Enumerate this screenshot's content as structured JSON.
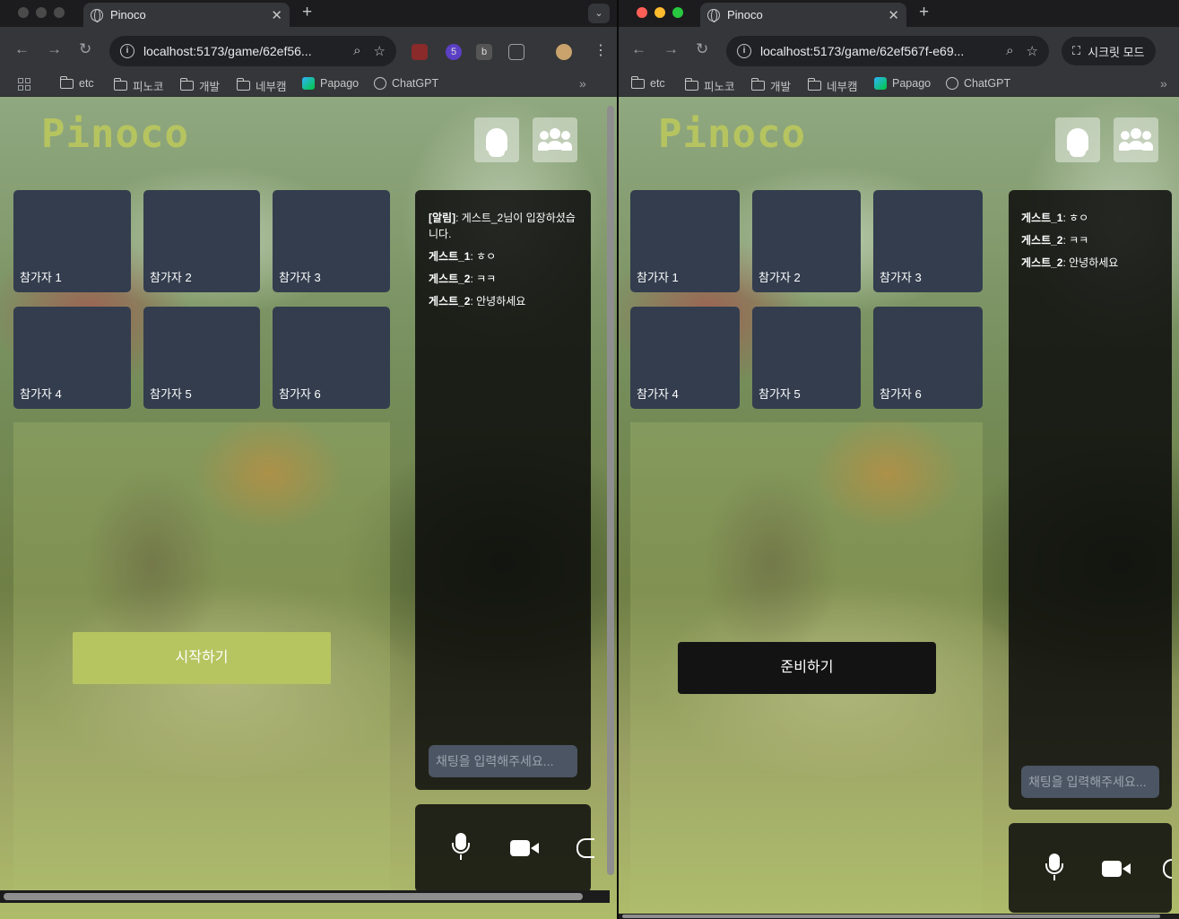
{
  "browser": {
    "tab_title": "Pinoco",
    "left_url": "localhost:5173/game/62ef56...",
    "right_url": "localhost:5173/game/62ef567f-e69...",
    "incognito_label": "시크릿 모드",
    "ext_badge": "5",
    "ext_b": "b",
    "bookmarks": [
      "etc",
      "피노코",
      "개발",
      "네부캠",
      "Papago",
      "ChatGPT"
    ],
    "more_bookmarks": "»"
  },
  "app": {
    "logo": "Pinoco",
    "participants": [
      "참가자 1",
      "참가자 2",
      "참가자 3",
      "참가자 4",
      "참가자 5",
      "참가자 6"
    ],
    "start_label": "시작하기",
    "ready_label": "준비하기",
    "chat_placeholder": "채팅을 입력해주세요...",
    "left_messages": [
      {
        "sender": "[알림]",
        "text": ": 게스트_2님이 입장하셨습니다."
      },
      {
        "sender": "게스트_1",
        "text": ": ㅎㅇ"
      },
      {
        "sender": "게스트_2",
        "text": ": ㅋㅋ"
      },
      {
        "sender": "게스트_2",
        "text": ": 안녕하세요"
      }
    ],
    "right_messages": [
      {
        "sender": "게스트_1",
        "text": ": ㅎㅇ"
      },
      {
        "sender": "게스트_2",
        "text": ": ㅋㅋ"
      },
      {
        "sender": "게스트_2",
        "text": ": 안녕하세요"
      }
    ]
  },
  "colors": {
    "accent": "#b7c561",
    "card": "#333d4e",
    "chat_bg": "#0a0a0a"
  }
}
